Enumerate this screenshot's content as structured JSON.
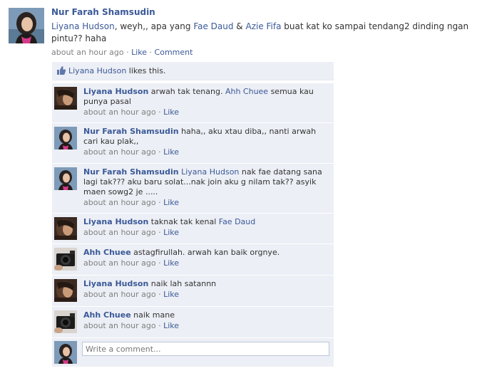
{
  "post": {
    "author": "Nur Farah Shamsudin",
    "message_parts": [
      {
        "text": "Liyana Hudson",
        "link": true
      },
      {
        "text": ", weyh,, apa yang ",
        "link": false
      },
      {
        "text": "Fae Daud",
        "link": true
      },
      {
        "text": " & ",
        "link": false
      },
      {
        "text": "Azie Fifa",
        "link": true
      },
      {
        "text": " buat kat ko sampai tendang2 dinding ngan pintu?? haha",
        "link": false
      }
    ],
    "time": "about an hour ago",
    "sep1": " · ",
    "like_label": "Like",
    "sep2": " · ",
    "comment_label": "Comment"
  },
  "likes": {
    "name": "Liyana Hudson",
    "suffix": " likes this."
  },
  "comments": [
    {
      "author": "Liyana Hudson",
      "avatar": "liyana-hudson",
      "parts": [
        {
          "text": " arwah tak tenang. ",
          "link": false
        },
        {
          "text": "Ahh Chuee",
          "link": true
        },
        {
          "text": " semua kau punya pasal",
          "link": false
        }
      ],
      "time": "about an hour ago",
      "like_label": "Like"
    },
    {
      "author": "Nur Farah Shamsudin",
      "avatar": "nur-farah",
      "parts": [
        {
          "text": " haha,, aku xtau diba,, nanti arwah cari kau plak,,",
          "link": false
        }
      ],
      "time": "about an hour ago",
      "like_label": "Like"
    },
    {
      "author": "Nur Farah Shamsudin",
      "avatar": "nur-farah",
      "parts": [
        {
          "text": " ",
          "link": false
        },
        {
          "text": "Liyana Hudson",
          "link": true
        },
        {
          "text": " nak fae datang sana lagi tak??? aku baru solat...nak join aku g nilam tak?? asyik maen sowg2 je .....",
          "link": false
        }
      ],
      "time": "about an hour ago",
      "like_label": "Like"
    },
    {
      "author": "Liyana Hudson",
      "avatar": "liyana-hudson",
      "parts": [
        {
          "text": " taknak tak kenal ",
          "link": false
        },
        {
          "text": "Fae Daud",
          "link": true
        }
      ],
      "time": "about an hour ago",
      "like_label": "Like"
    },
    {
      "author": "Ahh Chuee",
      "avatar": "ahh-chuee",
      "parts": [
        {
          "text": " astagfirullah. arwah kan baik orgnye.",
          "link": false
        }
      ],
      "time": "about an hour ago",
      "like_label": "Like"
    },
    {
      "author": "Liyana Hudson",
      "avatar": "liyana-hudson",
      "parts": [
        {
          "text": " naik lah satannn",
          "link": false
        }
      ],
      "time": "about an hour ago",
      "like_label": "Like"
    },
    {
      "author": "Ahh Chuee",
      "avatar": "ahh-chuee",
      "parts": [
        {
          "text": " naik mane",
          "link": false
        }
      ],
      "time": "about an hour ago",
      "like_label": "Like"
    }
  ],
  "compose": {
    "placeholder": "Write a comment..."
  },
  "colors": {
    "link": "#3b5998",
    "meta": "#808080",
    "ufi_bg": "#eceff5",
    "input_border": "#bdc7d8"
  },
  "icons": {
    "like": "thumbs-up-icon"
  }
}
